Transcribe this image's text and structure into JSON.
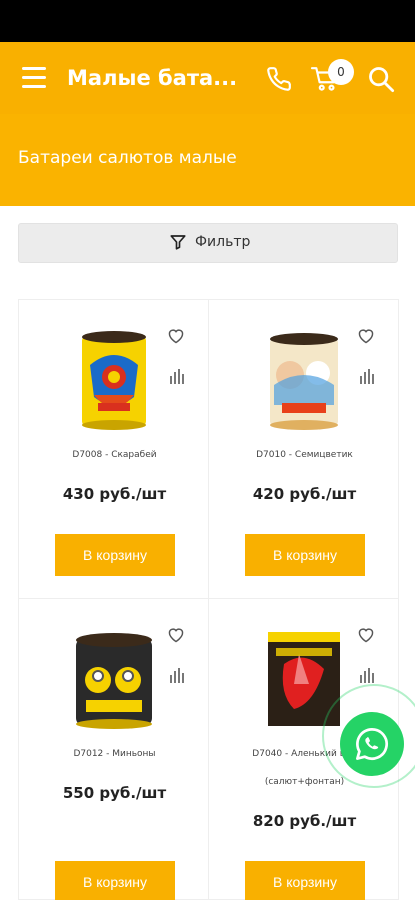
{
  "header": {
    "title": "Малые бата...",
    "cart_count": "0"
  },
  "banner": {
    "title": "Батареи салютов малые"
  },
  "filter": {
    "label": "Фильтр"
  },
  "products": [
    {
      "name": "D7008 - Скарабей",
      "price": "430 руб./шт",
      "button": "В корзину"
    },
    {
      "name": "D7010 - Семицветик",
      "price": "420 руб./шт",
      "button": "В корзину"
    },
    {
      "name": "D7012 - Миньоны",
      "price": "550 руб./шт",
      "button": "В корзину"
    },
    {
      "name": "D7040 - Аленький цве",
      "name_line2": "(салют+фонтан)",
      "price": "820 руб./шт",
      "button": "В корзину"
    }
  ],
  "colors": {
    "accent": "#f9b000",
    "whatsapp": "#25d366"
  },
  "icons": [
    "menu-icon",
    "phone-icon",
    "cart-icon",
    "search-icon",
    "filter-icon",
    "heart-icon",
    "chart-icon",
    "whatsapp-icon"
  ]
}
